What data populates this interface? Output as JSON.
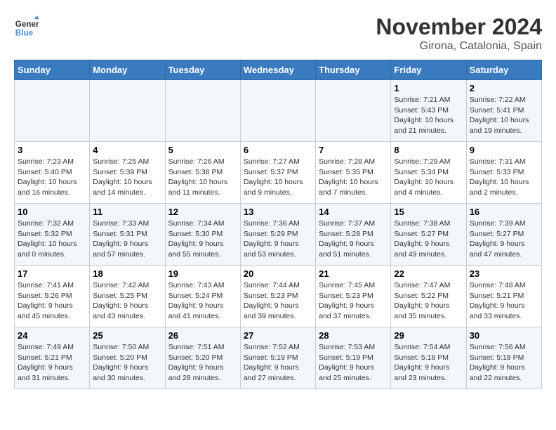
{
  "logo": {
    "line1": "General",
    "line2": "Blue"
  },
  "title": "November 2024",
  "location": "Girona, Catalonia, Spain",
  "days_header": [
    "Sunday",
    "Monday",
    "Tuesday",
    "Wednesday",
    "Thursday",
    "Friday",
    "Saturday"
  ],
  "weeks": [
    [
      {
        "day": "",
        "info": ""
      },
      {
        "day": "",
        "info": ""
      },
      {
        "day": "",
        "info": ""
      },
      {
        "day": "",
        "info": ""
      },
      {
        "day": "",
        "info": ""
      },
      {
        "day": "1",
        "info": "Sunrise: 7:21 AM\nSunset: 5:43 PM\nDaylight: 10 hours and 21 minutes."
      },
      {
        "day": "2",
        "info": "Sunrise: 7:22 AM\nSunset: 5:41 PM\nDaylight: 10 hours and 19 minutes."
      }
    ],
    [
      {
        "day": "3",
        "info": "Sunrise: 7:23 AM\nSunset: 5:40 PM\nDaylight: 10 hours and 16 minutes."
      },
      {
        "day": "4",
        "info": "Sunrise: 7:25 AM\nSunset: 5:39 PM\nDaylight: 10 hours and 14 minutes."
      },
      {
        "day": "5",
        "info": "Sunrise: 7:26 AM\nSunset: 5:38 PM\nDaylight: 10 hours and 11 minutes."
      },
      {
        "day": "6",
        "info": "Sunrise: 7:27 AM\nSunset: 5:37 PM\nDaylight: 10 hours and 9 minutes."
      },
      {
        "day": "7",
        "info": "Sunrise: 7:28 AM\nSunset: 5:35 PM\nDaylight: 10 hours and 7 minutes."
      },
      {
        "day": "8",
        "info": "Sunrise: 7:29 AM\nSunset: 5:34 PM\nDaylight: 10 hours and 4 minutes."
      },
      {
        "day": "9",
        "info": "Sunrise: 7:31 AM\nSunset: 5:33 PM\nDaylight: 10 hours and 2 minutes."
      }
    ],
    [
      {
        "day": "10",
        "info": "Sunrise: 7:32 AM\nSunset: 5:32 PM\nDaylight: 10 hours and 0 minutes."
      },
      {
        "day": "11",
        "info": "Sunrise: 7:33 AM\nSunset: 5:31 PM\nDaylight: 9 hours and 57 minutes."
      },
      {
        "day": "12",
        "info": "Sunrise: 7:34 AM\nSunset: 5:30 PM\nDaylight: 9 hours and 55 minutes."
      },
      {
        "day": "13",
        "info": "Sunrise: 7:36 AM\nSunset: 5:29 PM\nDaylight: 9 hours and 53 minutes."
      },
      {
        "day": "14",
        "info": "Sunrise: 7:37 AM\nSunset: 5:28 PM\nDaylight: 9 hours and 51 minutes."
      },
      {
        "day": "15",
        "info": "Sunrise: 7:38 AM\nSunset: 5:27 PM\nDaylight: 9 hours and 49 minutes."
      },
      {
        "day": "16",
        "info": "Sunrise: 7:39 AM\nSunset: 5:27 PM\nDaylight: 9 hours and 47 minutes."
      }
    ],
    [
      {
        "day": "17",
        "info": "Sunrise: 7:41 AM\nSunset: 5:26 PM\nDaylight: 9 hours and 45 minutes."
      },
      {
        "day": "18",
        "info": "Sunrise: 7:42 AM\nSunset: 5:25 PM\nDaylight: 9 hours and 43 minutes."
      },
      {
        "day": "19",
        "info": "Sunrise: 7:43 AM\nSunset: 5:24 PM\nDaylight: 9 hours and 41 minutes."
      },
      {
        "day": "20",
        "info": "Sunrise: 7:44 AM\nSunset: 5:23 PM\nDaylight: 9 hours and 39 minutes."
      },
      {
        "day": "21",
        "info": "Sunrise: 7:45 AM\nSunset: 5:23 PM\nDaylight: 9 hours and 37 minutes."
      },
      {
        "day": "22",
        "info": "Sunrise: 7:47 AM\nSunset: 5:22 PM\nDaylight: 9 hours and 35 minutes."
      },
      {
        "day": "23",
        "info": "Sunrise: 7:48 AM\nSunset: 5:21 PM\nDaylight: 9 hours and 33 minutes."
      }
    ],
    [
      {
        "day": "24",
        "info": "Sunrise: 7:49 AM\nSunset: 5:21 PM\nDaylight: 9 hours and 31 minutes."
      },
      {
        "day": "25",
        "info": "Sunrise: 7:50 AM\nSunset: 5:20 PM\nDaylight: 9 hours and 30 minutes."
      },
      {
        "day": "26",
        "info": "Sunrise: 7:51 AM\nSunset: 5:20 PM\nDaylight: 9 hours and 28 minutes."
      },
      {
        "day": "27",
        "info": "Sunrise: 7:52 AM\nSunset: 5:19 PM\nDaylight: 9 hours and 27 minutes."
      },
      {
        "day": "28",
        "info": "Sunrise: 7:53 AM\nSunset: 5:19 PM\nDaylight: 9 hours and 25 minutes."
      },
      {
        "day": "29",
        "info": "Sunrise: 7:54 AM\nSunset: 5:18 PM\nDaylight: 9 hours and 23 minutes."
      },
      {
        "day": "30",
        "info": "Sunrise: 7:56 AM\nSunset: 5:18 PM\nDaylight: 9 hours and 22 minutes."
      }
    ]
  ]
}
